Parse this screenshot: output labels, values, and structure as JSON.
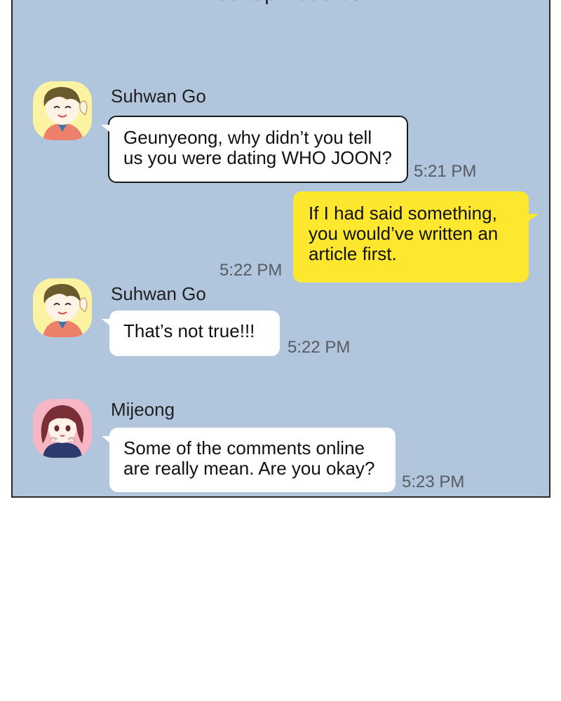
{
  "header": {
    "title": "Rooftop Buddies"
  },
  "messages": [
    {
      "sender": "Suhwan Go",
      "lines": [
        "Geunyeong, why didn’t you tell",
        "us you were dating WHO JOON?"
      ],
      "time": "5:21 PM",
      "avatar": "suhwan-avatar"
    },
    {
      "sender": "",
      "lines": [
        "If I had said something,",
        "you would’ve written an",
        "article first."
      ],
      "time": "5:22 PM",
      "outgoing": true
    },
    {
      "sender": "Suhwan Go",
      "lines": [
        "That’s not true!!!"
      ],
      "time": "5:22 PM",
      "avatar": "suhwan-avatar"
    },
    {
      "sender": "Mijeong",
      "lines": [
        "Some of the comments online",
        "are really mean. Are you okay?"
      ],
      "time": "5:23 PM",
      "avatar": "mijeong-avatar"
    }
  ],
  "colors": {
    "chat_bg": "#b1c6dc",
    "outgoing_bubble": "#fde82f",
    "incoming_bubble": "#ffffff",
    "suhwan_avatar_bg": "#fbf3a1",
    "mijeong_avatar_bg": "#f6b6c3"
  }
}
